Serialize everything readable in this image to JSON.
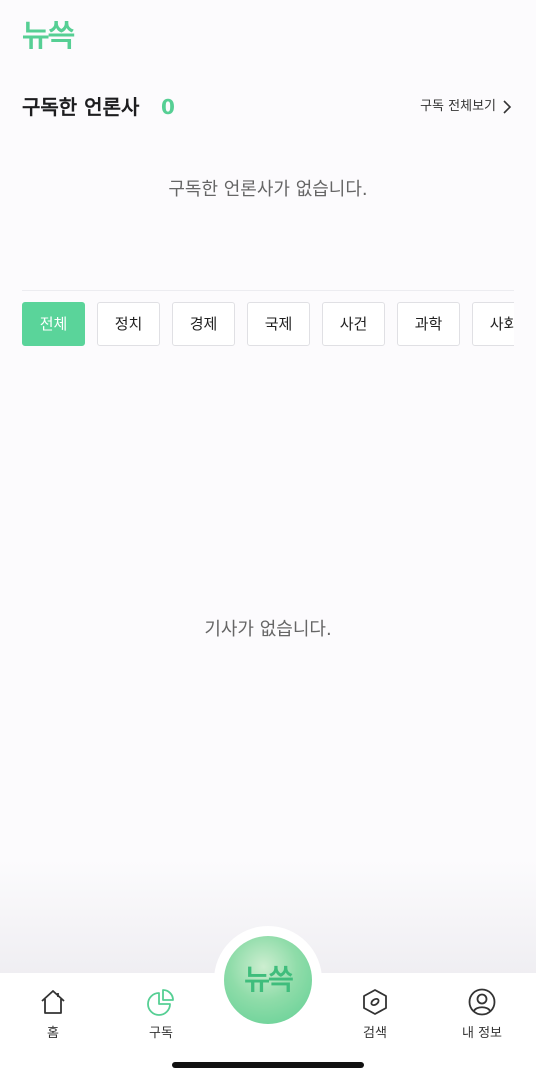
{
  "header": {
    "logo_text": "뉴쓱"
  },
  "subscribed": {
    "title": "구독한 언론사",
    "count": "0",
    "view_all_label": "구독 전체보기",
    "empty_message": "구독한 언론사가 없습니다."
  },
  "categories": {
    "selected": "전체",
    "items": [
      "전체",
      "정치",
      "경제",
      "국제",
      "사건",
      "과학",
      "사회"
    ]
  },
  "articles": {
    "empty_message": "기사가 없습니다."
  },
  "tabbar": {
    "home_label": "홈",
    "subscribe_label": "구독",
    "center_logo_text": "뉴쓱",
    "search_label": "검색",
    "profile_label": "내 정보",
    "active": "구독"
  },
  "colors": {
    "accent": "#56cf94",
    "chip_active_bg": "#5ad49a",
    "text_muted": "#666666"
  }
}
